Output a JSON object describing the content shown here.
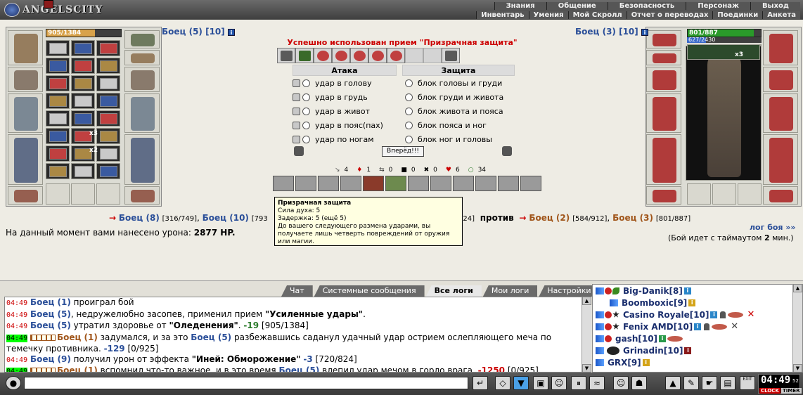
{
  "header": {
    "logo_text": "ANGELSCITY",
    "menu_top": [
      "Знания",
      "Общение",
      "Безопасность",
      "Персонаж",
      "Выход"
    ],
    "menu_bottom": [
      "Инвентарь",
      "Умения",
      "Мой Скролл",
      "Отчет о переводах",
      "Поединки",
      "Анкета"
    ]
  },
  "left_fighter": {
    "name": "Боец (5) [10]",
    "hp_text": "905/1384",
    "hp_fraction": 0.654,
    "counts": [
      "x3",
      "x2"
    ]
  },
  "right_fighter": {
    "name": "Боец (3) [10]",
    "hp_text": "801/887",
    "hp_fraction": 0.903,
    "mp_text": "627/2430",
    "mp_fraction": 0.258,
    "counts": [
      "x3"
    ]
  },
  "combat": {
    "success_message": "Успешно использован прием \"Призрачная защита\"",
    "attack_header": "Атака",
    "defense_header": "Защита",
    "attacks": [
      "удар в голову",
      "удар в грудь",
      "удар в живот",
      "удар в пояс(пах)",
      "удар по ногам"
    ],
    "defenses": [
      "блок головы и груди",
      "блок груди и живота",
      "блок живота и пояса",
      "блок пояса и ног",
      "блок ног и головы"
    ],
    "go_button": "Вперёд!!!",
    "stats": [
      "4",
      "1",
      "0",
      "0",
      "0",
      "6",
      "34"
    ]
  },
  "tooltip": {
    "title": "Призрачная защита",
    "line1": "Сила духа: 5",
    "line2": "Задержка: 5 (ещё 5)",
    "line3": "До вашего следующего размена ударами, вы",
    "line4": "получаете лишь четверть повреждений от оружия",
    "line5": "или магии."
  },
  "versus": {
    "team1_a": "Боец (8)",
    "team1_a_hp": "[316/749]",
    "team1_b": "Боец (10)",
    "team1_b_hp": "[793",
    "team1_tail": "24]",
    "vs_word": "против",
    "team2_a": "Боец (2)",
    "team2_a_hp": "[584/912]",
    "team2_b": "Боец (3)",
    "team2_b_hp": "[801/887]"
  },
  "damage": {
    "label": "На данный момент вами нанесено урона:",
    "value": "2877 HP."
  },
  "battle_log_link": "лог боя »»",
  "timeout": {
    "pre": "(Бой идет с таймаутом",
    "num": "2",
    "post": "мин.)"
  },
  "chat_tabs": [
    "Чат",
    "Системные сообщения",
    "Все логи",
    "Мои логи",
    "Настройки"
  ],
  "log": [
    {
      "time": "04:49",
      "parts": [
        {
          "c": "b",
          "t": "Боец (1)"
        },
        {
          "c": "",
          "t": " проиграл бой"
        }
      ]
    },
    {
      "time": "04:49",
      "parts": [
        {
          "c": "b",
          "t": "Боец (5)"
        },
        {
          "c": "",
          "t": ", недружелюбно засопев, применил прием "
        },
        {
          "c": "k",
          "t": "\"Усиленные удары\""
        },
        {
          "c": "",
          "t": "."
        }
      ]
    },
    {
      "time": "04:49",
      "parts": [
        {
          "c": "b",
          "t": "Боец (5)"
        },
        {
          "c": "",
          "t": " утратил здоровье от "
        },
        {
          "c": "k",
          "t": "\"Оледенения\""
        },
        {
          "c": "",
          "t": ". "
        },
        {
          "c": "g",
          "t": "-19"
        },
        {
          "c": "",
          "t": " [905/1384]"
        }
      ]
    },
    {
      "time": "04:49",
      "hl": true,
      "sq": true,
      "parts": [
        {
          "c": "o",
          "t": "Боец (1)"
        },
        {
          "c": "",
          "t": " задумался, и за это "
        },
        {
          "c": "b",
          "t": "Боец (5)"
        },
        {
          "c": "",
          "t": " разбежавшись саданул удачный удар острием ослепляющего меча по"
        }
      ]
    },
    {
      "time": "",
      "parts": [
        {
          "c": "",
          "t": "темечку противника. "
        },
        {
          "c": "bl",
          "t": "-129"
        },
        {
          "c": "",
          "t": " [0/925]"
        }
      ]
    },
    {
      "time": "04:49",
      "parts": [
        {
          "c": "b",
          "t": "Боец (9)"
        },
        {
          "c": "",
          "t": " получил урон от эффекта "
        },
        {
          "c": "k",
          "t": "\"Иней: Обморожение\""
        },
        {
          "c": "",
          "t": " "
        },
        {
          "c": "bl",
          "t": "-3"
        },
        {
          "c": "",
          "t": " [720/824]"
        }
      ]
    },
    {
      "time": "04:49",
      "hl": true,
      "sq": true,
      "parts": [
        {
          "c": "o",
          "t": "Боец (1)"
        },
        {
          "c": "",
          "t": " вспомнил что-то важное, и в это время "
        },
        {
          "c": "b",
          "t": "Боец (5)"
        },
        {
          "c": "",
          "t": " влепил удар мечом в горло врага. "
        },
        {
          "c": "rd",
          "t": "-1250"
        },
        {
          "c": "",
          "t": " [0/925]"
        }
      ]
    }
  ],
  "users": [
    {
      "name": "Big-Danik",
      "lvl": "[8]"
    },
    {
      "name": "Boomboxic",
      "lvl": "[9]"
    },
    {
      "name": "Casino Royale",
      "lvl": "[10]"
    },
    {
      "name": "Fenix AMD",
      "lvl": "[10]"
    },
    {
      "name": "gash",
      "lvl": "[10]"
    },
    {
      "name": "Grinadin",
      "lvl": "[10]"
    },
    {
      "name": "GRX",
      "lvl": "[9]"
    }
  ],
  "clock": {
    "time": "04:49",
    "seconds": "52",
    "label_clock": "CLOCK",
    "label_timer": "TIMER",
    "exit": "EXIT"
  },
  "colors": {
    "fighter_blue": "#2b4f99",
    "fighter_orange": "#a0551a",
    "success_red": "#cc0000",
    "hp_bar": "#d8a24a",
    "hp_bar_green": "#2a7a2a"
  }
}
